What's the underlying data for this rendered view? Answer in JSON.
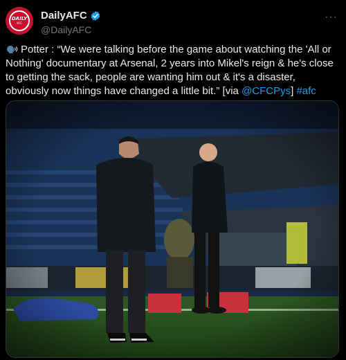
{
  "account": {
    "display_name": "DailyAFC",
    "handle": "@DailyAFC",
    "avatar_text": "DAILY",
    "avatar_sub": "AFC"
  },
  "tweet": {
    "lead": "Potter : “We were talking before the game about watching the 'All or Nothing' documentary at Arsenal, 2 years into Mikel's reign & he's close to getting the sack, people are wanting him out & it's a disaster, obviously now things have changed a little bit.” [via ",
    "mention": "@CFCPys",
    "close": "] ",
    "hashtag": "#afc"
  },
  "icons": {
    "speaker": "speaking-head-icon",
    "verified": "verified-badge-icon",
    "more": "more-options-icon"
  },
  "colors": {
    "link": "#1d9bf0",
    "verified": "#1d9bf0",
    "brand": "#c8102e"
  }
}
